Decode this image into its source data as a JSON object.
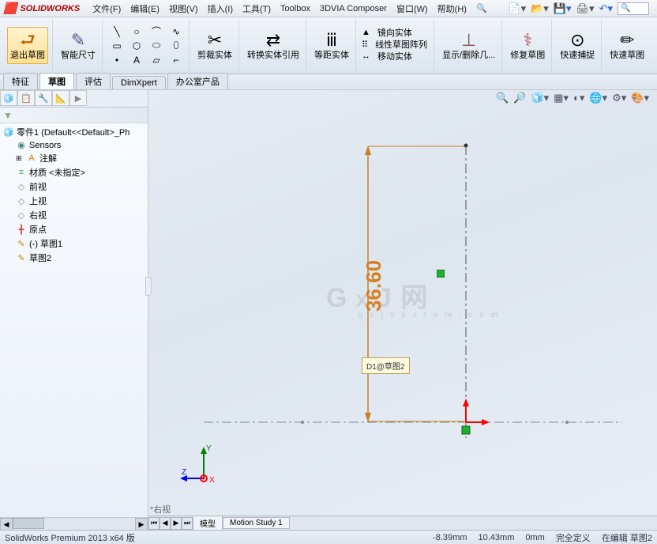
{
  "app": {
    "logo": "SOLIDWORKS"
  },
  "menu": {
    "file": "文件(F)",
    "edit": "编辑(E)",
    "view": "视图(V)",
    "insert": "插入(I)",
    "tools": "工具(T)",
    "toolbox": "Toolbox",
    "composer": "3DVIA Composer",
    "window": "窗口(W)",
    "help": "帮助(H)"
  },
  "ribbon": {
    "exit_sketch": "退出草图",
    "smart_dim": "智能尺寸",
    "trim": "剪裁实体",
    "convert": "转换实体引用",
    "offset": "等距实体",
    "mirror": "镜向实体",
    "linear_pattern": "线性草图阵列",
    "move": "移动实体",
    "display_delete": "显示/删除几...",
    "repair": "修复草图",
    "quick_snap": "快速捕捉",
    "rapid_sketch": "快速草图"
  },
  "tabs": {
    "features": "特征",
    "sketch": "草图",
    "evaluate": "评估",
    "dimxpert": "DimXpert",
    "office": "办公室产品"
  },
  "tree": {
    "root": "零件1  (Default<<Default>_Ph",
    "sensors": "Sensors",
    "annotations": "注解",
    "material": "材质 <未指定>",
    "front": "前视",
    "top": "上视",
    "right": "右视",
    "origin": "原点",
    "sketch1": "(-) 草图1",
    "sketch2": "草图2"
  },
  "viewport": {
    "dim_value": "36.60",
    "tooltip": "D1@草图2",
    "view_label": "*右视"
  },
  "bottom_tabs": {
    "model": "模型",
    "motion": "Motion Study 1"
  },
  "status": {
    "product": "SolidWorks Premium 2013 x64 版",
    "x": "-8.39mm",
    "y": "10.43mm",
    "z": "0mm",
    "defined": "完全定义",
    "editing": "在编辑 草图2"
  }
}
